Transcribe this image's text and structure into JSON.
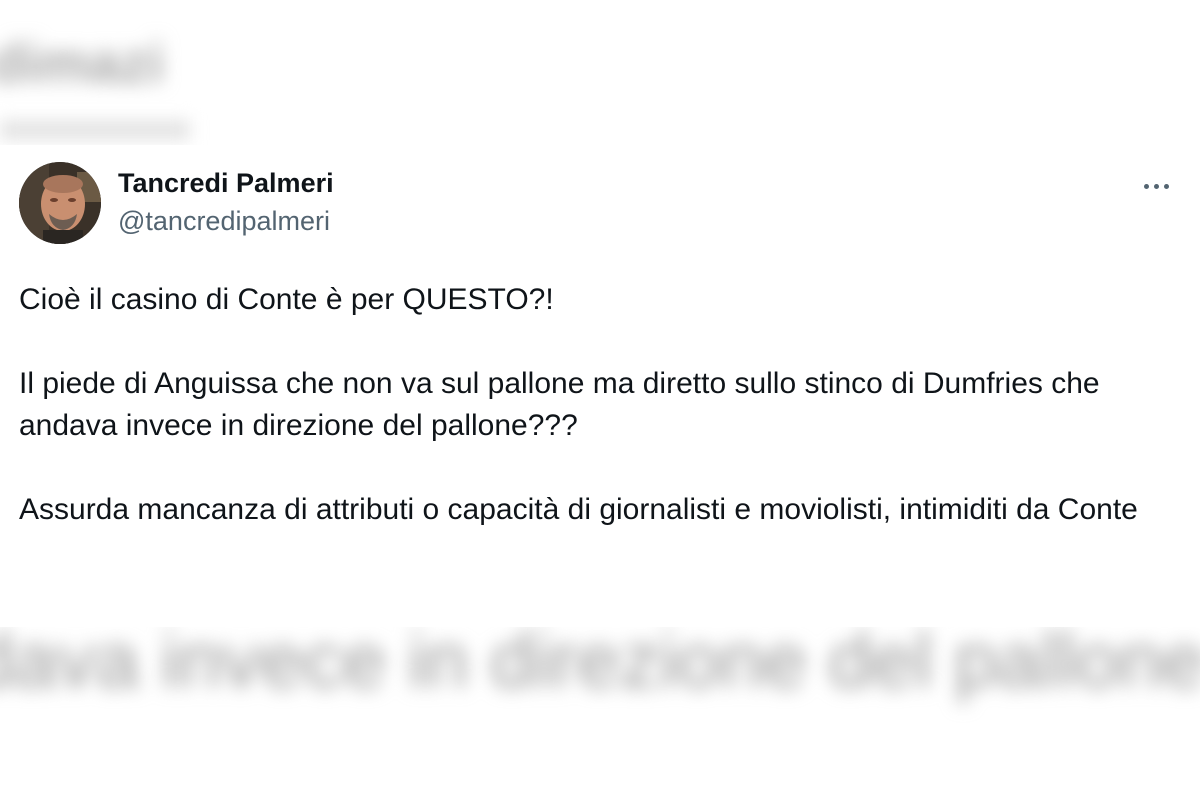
{
  "background": {
    "blurred_top_text": "dimazi",
    "blurred_bottom_text": "dava invece in direzione del pallone"
  },
  "tweet": {
    "author": {
      "name": "Tancredi Palmeri",
      "handle": "@tancredipalmeri",
      "avatar_icon": "profile-photo"
    },
    "more_icon": "more-options-icon",
    "paragraphs": [
      "Cioè il casino di Conte è per QUESTO?!",
      "Il piede di Anguissa che non va sul pallone ma diretto sullo stinco di Dumfries che andava invece in direzione del pallone???",
      "Assurda mancanza di attributi o capacità di giornalisti e moviolisti, intimiditi da Conte"
    ]
  },
  "colors": {
    "text_primary": "#0f1419",
    "text_secondary": "#536471",
    "card_background": "#ffffff"
  }
}
